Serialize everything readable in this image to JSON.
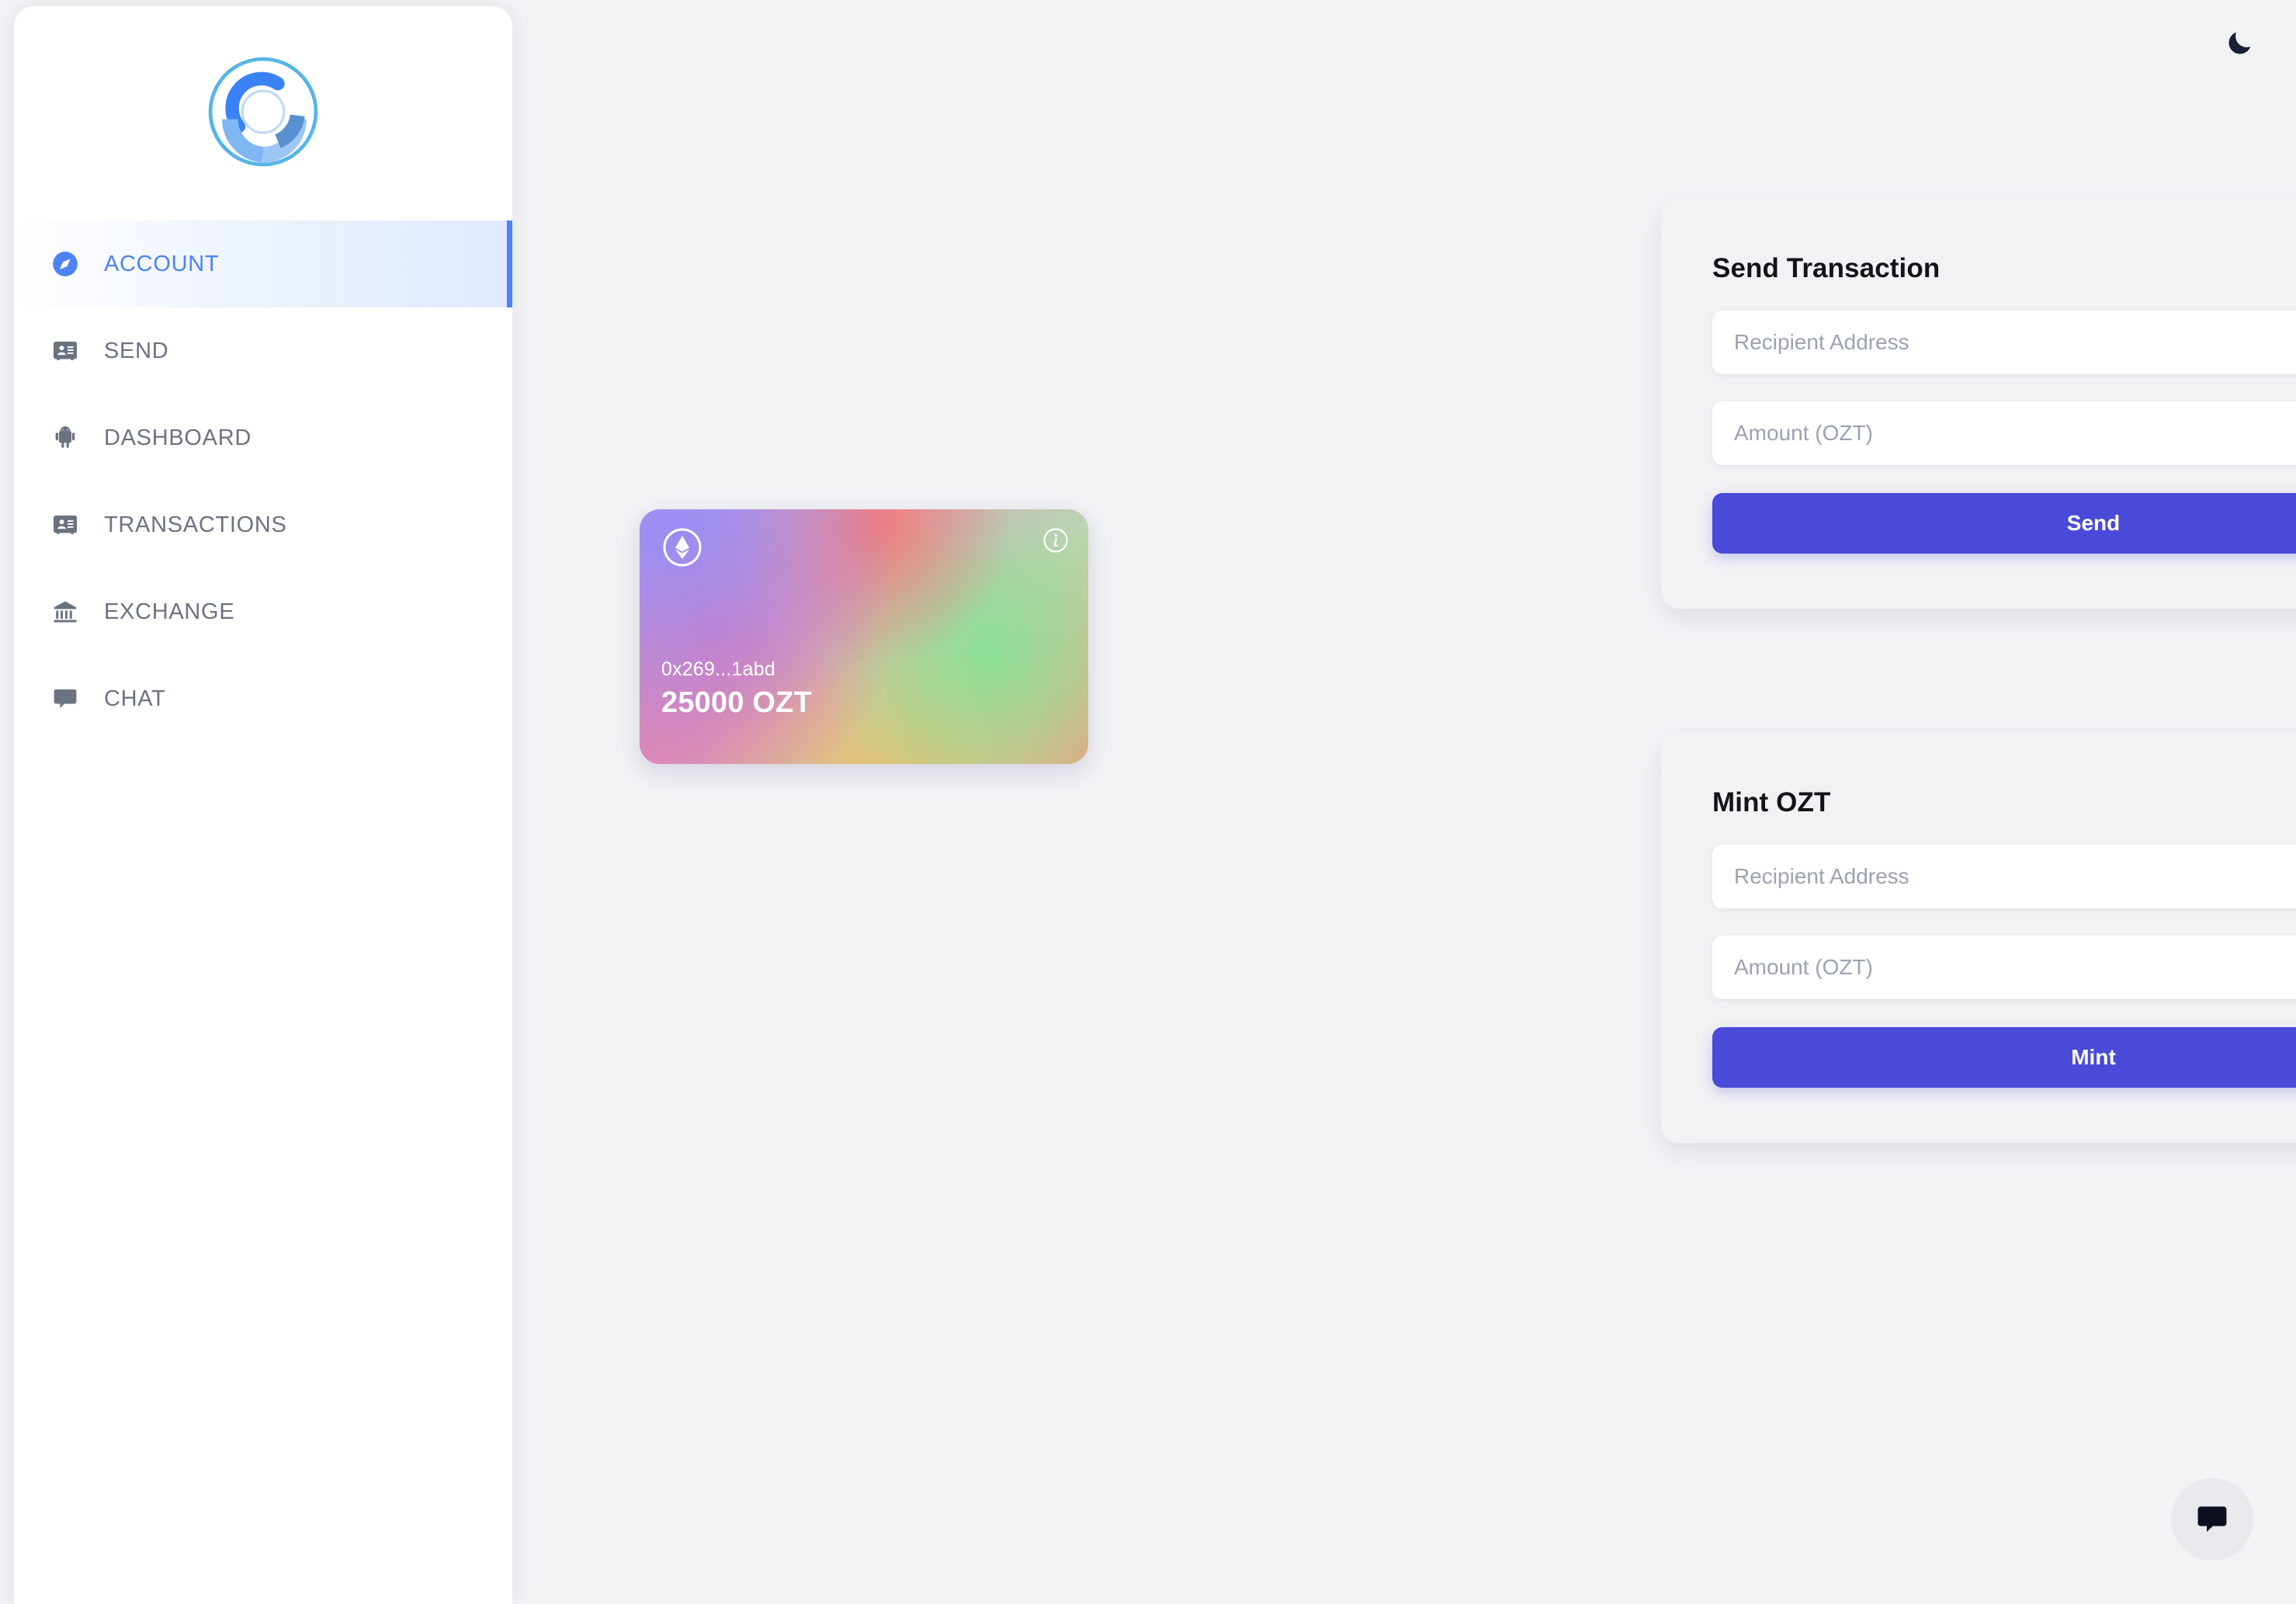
{
  "sidebar": {
    "logo_name": "ozt-logo",
    "items": [
      {
        "label": "ACCOUNT",
        "icon": "compass-icon",
        "active": true
      },
      {
        "label": "SEND",
        "icon": "contact-card-icon",
        "active": false
      },
      {
        "label": "DASHBOARD",
        "icon": "android-icon",
        "active": false
      },
      {
        "label": "TRANSACTIONS",
        "icon": "contact-card-icon",
        "active": false
      },
      {
        "label": "EXCHANGE",
        "icon": "bank-icon",
        "active": false
      },
      {
        "label": "CHAT",
        "icon": "chat-bubble-icon",
        "active": false
      }
    ]
  },
  "header": {
    "theme_toggle_icon": "moon-icon",
    "theme_toggle_label": "Toggle dark mode"
  },
  "wallet_card": {
    "token_icon": "ethereum-icon",
    "info_icon": "info-icon",
    "address": "0x269...1abd",
    "balance": "25000 OZT"
  },
  "panels": [
    {
      "id": "send",
      "title": "Send Transaction",
      "recipient_placeholder": "Recipient Address",
      "recipient_value": "",
      "amount_placeholder": "Amount (OZT)",
      "amount_value": "",
      "button_label": "Send"
    },
    {
      "id": "mint",
      "title": "Mint OZT",
      "recipient_placeholder": "Recipient Address",
      "recipient_value": "",
      "amount_placeholder": "Amount (OZT)",
      "amount_value": "",
      "button_label": "Mint"
    }
  ],
  "chat_fab": {
    "icon": "chat-bubble-icon",
    "label": "Open chat"
  },
  "colors": {
    "page_bg": "#f1f3f5",
    "sidebar_bg": "#ffffff",
    "panel_bg": "#f1f2f4",
    "accent_button": "#4a4ad8",
    "active_nav": "#4d82f3",
    "nav_text": "#6b7280",
    "placeholder": "#9ba2b0",
    "title_text": "#111418"
  }
}
